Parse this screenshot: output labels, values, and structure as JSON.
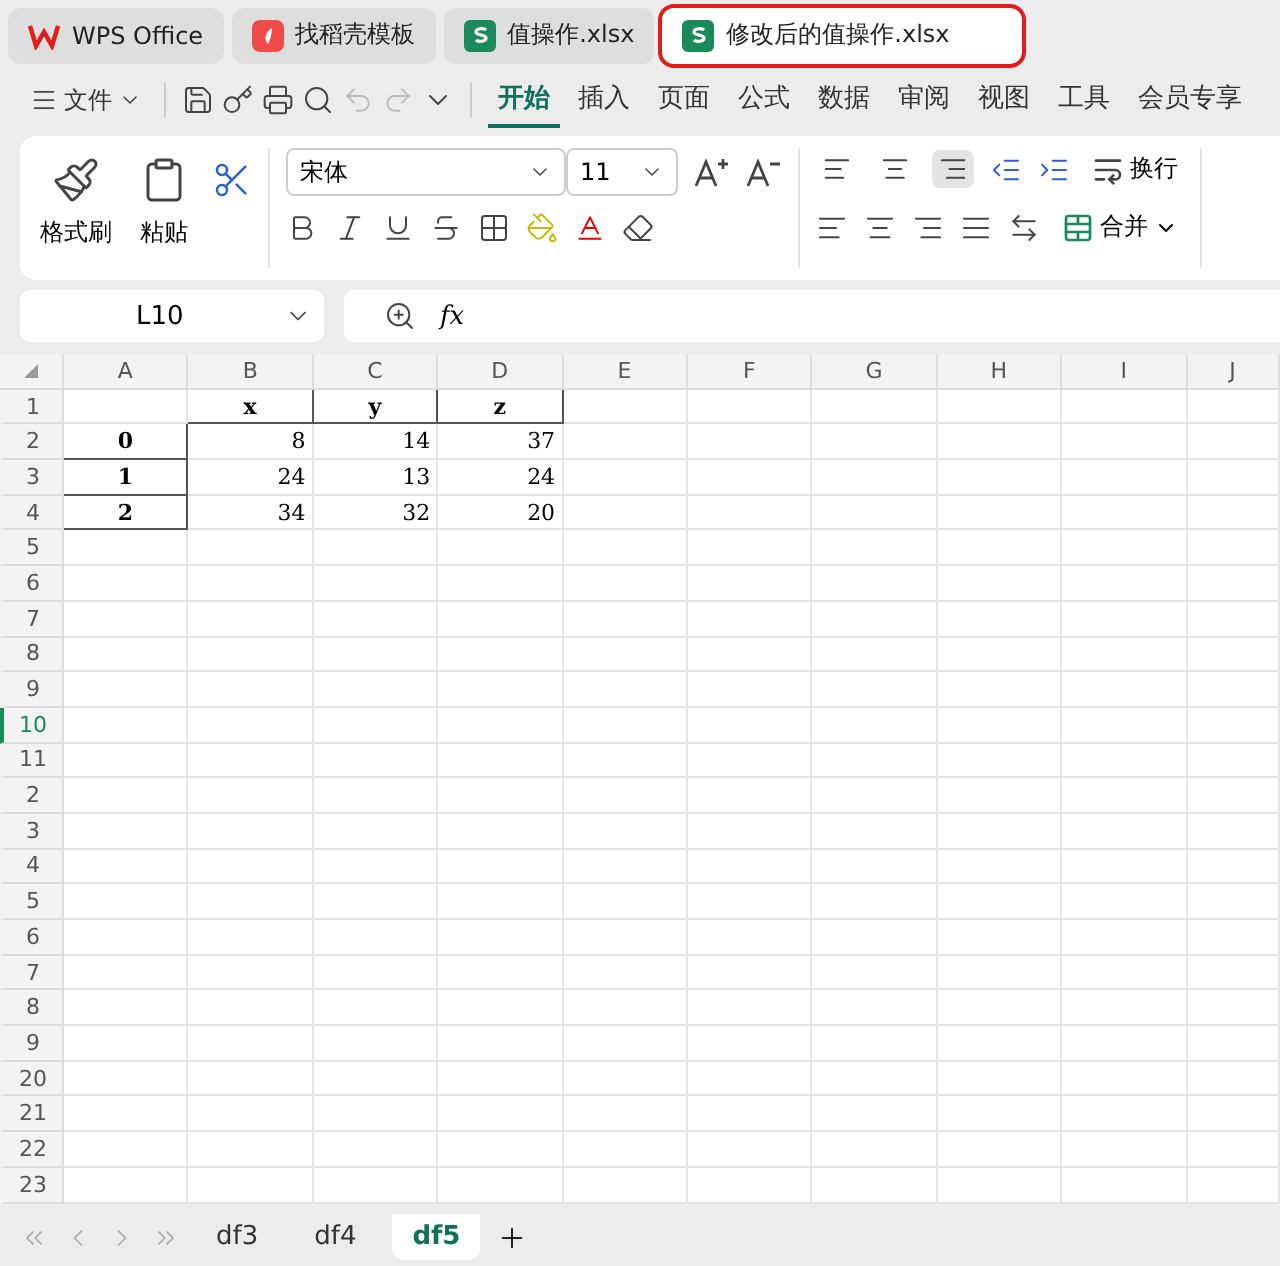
{
  "tabs": [
    {
      "kind": "home",
      "label": "WPS Office",
      "selected": false,
      "highlighted": false
    },
    {
      "kind": "template",
      "label": "找稻壳模板",
      "selected": false,
      "highlighted": false
    },
    {
      "kind": "sheet",
      "label": "值操作.xlsx",
      "selected": false,
      "highlighted": false
    },
    {
      "kind": "sheet",
      "label": "修改后的值操作.xlsx",
      "selected": true,
      "highlighted": true
    }
  ],
  "menu": {
    "file": "文件",
    "items": [
      {
        "label": "开始",
        "selected": true
      },
      {
        "label": "插入",
        "selected": false
      },
      {
        "label": "页面",
        "selected": false
      },
      {
        "label": "公式",
        "selected": false
      },
      {
        "label": "数据",
        "selected": false
      },
      {
        "label": "审阅",
        "selected": false
      },
      {
        "label": "视图",
        "selected": false
      },
      {
        "label": "工具",
        "selected": false
      },
      {
        "label": "会员专享",
        "selected": false
      }
    ]
  },
  "ribbon": {
    "format_painter": "格式刷",
    "paste": "粘贴",
    "font": "宋体",
    "size": "11",
    "wrap": "换行",
    "merge": "合并",
    "valign": [
      {
        "kind": "top",
        "selected": false
      },
      {
        "kind": "middle",
        "selected": false
      },
      {
        "kind": "bottom",
        "selected": true
      }
    ]
  },
  "formula_bar": {
    "name_box": "L10",
    "fx": "fx"
  },
  "grid": {
    "columns": [
      "A",
      "B",
      "C",
      "D",
      "E",
      "F",
      "G",
      "H",
      "I",
      "J"
    ],
    "rows": [
      {
        "label": "1",
        "selected": false
      },
      {
        "label": "2",
        "selected": false
      },
      {
        "label": "3",
        "selected": false
      },
      {
        "label": "4",
        "selected": false
      },
      {
        "label": "5",
        "selected": false
      },
      {
        "label": "6",
        "selected": false
      },
      {
        "label": "7",
        "selected": false
      },
      {
        "label": "8",
        "selected": false
      },
      {
        "label": "9",
        "selected": false
      },
      {
        "label": "10",
        "selected": true
      },
      {
        "label": "11",
        "selected": false
      },
      {
        "label": "2",
        "selected": false
      },
      {
        "label": "3",
        "selected": false
      },
      {
        "label": "4",
        "selected": false
      },
      {
        "label": "5",
        "selected": false
      },
      {
        "label": "6",
        "selected": false
      },
      {
        "label": "7",
        "selected": false
      },
      {
        "label": "8",
        "selected": false
      },
      {
        "label": "9",
        "selected": false
      },
      {
        "label": "20",
        "selected": false
      },
      {
        "label": "21",
        "selected": false
      },
      {
        "label": "22",
        "selected": false
      },
      {
        "label": "23",
        "selected": false
      }
    ],
    "table": {
      "headers": [
        "x",
        "y",
        "z"
      ],
      "rows": [
        {
          "index": "0",
          "values": [
            "8",
            "14",
            "37"
          ]
        },
        {
          "index": "1",
          "values": [
            "24",
            "13",
            "24"
          ]
        },
        {
          "index": "2",
          "values": [
            "34",
            "32",
            "20"
          ]
        }
      ]
    }
  },
  "sheets": [
    {
      "label": "df3",
      "selected": false
    },
    {
      "label": "df4",
      "selected": false
    },
    {
      "label": "df5",
      "selected": true
    }
  ]
}
